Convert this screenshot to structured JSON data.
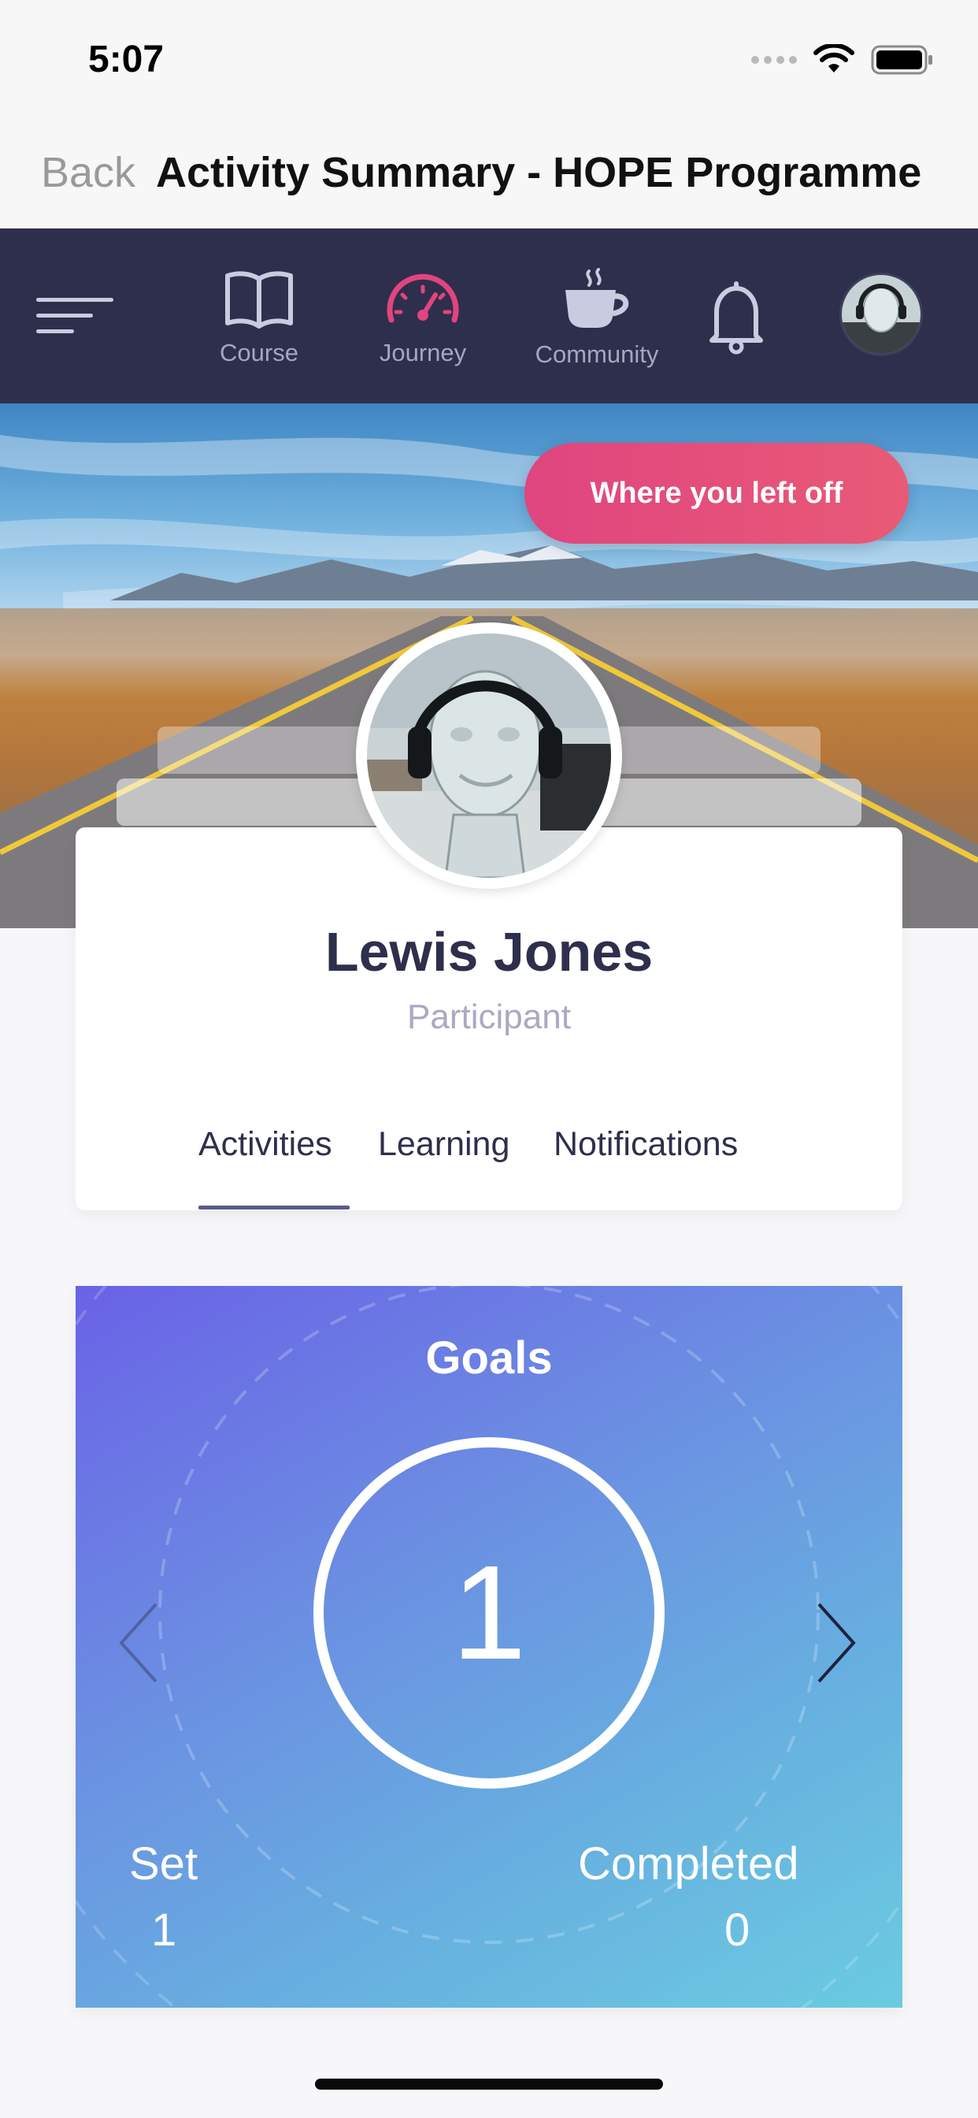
{
  "status_bar": {
    "time": "5:07"
  },
  "nav": {
    "back_label": "Back",
    "title": "Activity Summary - HOPE Programme"
  },
  "toolbar": {
    "items": [
      {
        "label": "Course",
        "icon": "book-icon"
      },
      {
        "label": "Journey",
        "icon": "speedometer-icon",
        "active": true
      },
      {
        "label": "Community",
        "icon": "coffee-cup-icon"
      }
    ],
    "accent_color": "#e0457f",
    "background_color": "#2e2f4c"
  },
  "hero": {
    "resume_label": "Where you left off"
  },
  "profile": {
    "name": "Lewis Jones",
    "role": "Participant",
    "tabs": [
      {
        "label": "Activities",
        "selected": true
      },
      {
        "label": "Learning",
        "selected": false
      },
      {
        "label": "Notifications",
        "selected": false
      }
    ]
  },
  "goals": {
    "title": "Goals",
    "count": "1",
    "set_label": "Set",
    "set_value": "1",
    "completed_label": "Completed",
    "completed_value": "0"
  }
}
